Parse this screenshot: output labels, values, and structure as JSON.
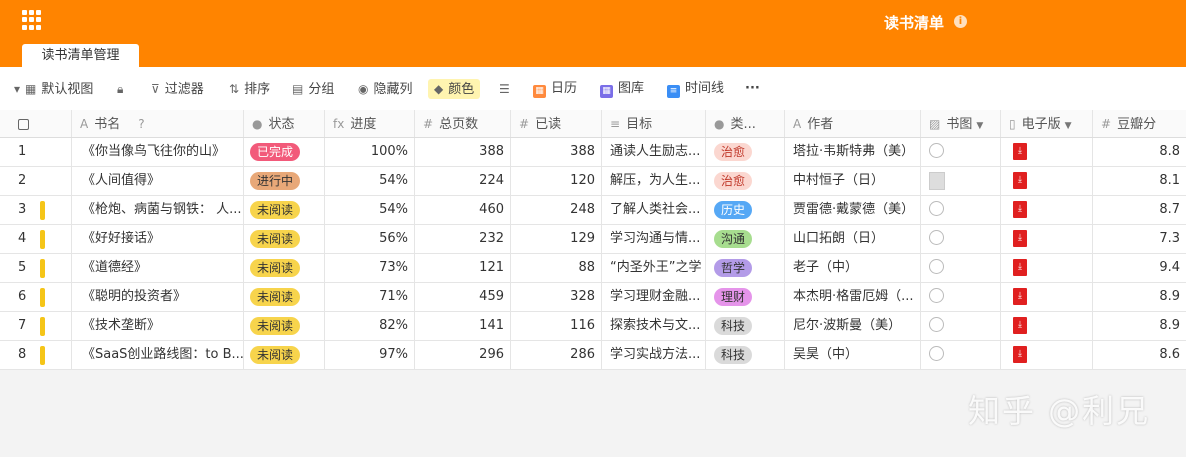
{
  "header": {
    "title": "读书清单",
    "tab": "读书清单管理"
  },
  "toolbar": {
    "view": "默认视图",
    "filter": "过滤器",
    "sort": "排序",
    "group": "分组",
    "hide": "隐藏列",
    "color": "颜色",
    "calendar": "日历",
    "gallery": "图库",
    "timeline": "时间线",
    "more": "···"
  },
  "columns": {
    "name": "书名",
    "status": "状态",
    "progress": "进度",
    "pages": "总页数",
    "read": "已读",
    "goal": "目标",
    "category": "类...",
    "author": "作者",
    "cover": "书图",
    "ebook": "电子版",
    "score": "豆瓣分"
  },
  "colors": {
    "accent": "#ff8400",
    "done": "#f25a7a",
    "inprogress": "#e8a878",
    "unread": "#f7d44c",
    "heal": "#fbd7d0",
    "history": "#56a8f5",
    "communicate": "#a7dd8f",
    "philosophy": "#b39be8",
    "finance": "#e594ea",
    "tech": "#dadada"
  },
  "rows": [
    {
      "n": "1",
      "name": "《你当像鸟飞往你的山》",
      "status": "已完成",
      "progress": "100%",
      "pages": "388",
      "read": "388",
      "goal": "通读人生励志...",
      "cat": "治愈",
      "author": "塔拉·韦斯特弗（美）",
      "score": "8.8"
    },
    {
      "n": "2",
      "name": "《人间值得》",
      "status": "进行中",
      "progress": "54%",
      "pages": "224",
      "read": "120",
      "goal": "解压，为人生...",
      "cat": "治愈",
      "author": "中村恒子（日）",
      "score": "8.1"
    },
    {
      "n": "3",
      "name": "《枪炮、病菌与钢铁： 人...",
      "status": "未阅读",
      "progress": "54%",
      "pages": "460",
      "read": "248",
      "goal": "了解人类社会...",
      "cat": "历史",
      "author": "贾雷德·戴蒙德（美）",
      "score": "8.7"
    },
    {
      "n": "4",
      "name": "《好好接话》",
      "status": "未阅读",
      "progress": "56%",
      "pages": "232",
      "read": "129",
      "goal": "学习沟通与情...",
      "cat": "沟通",
      "author": "山口拓朗（日）",
      "score": "7.3"
    },
    {
      "n": "5",
      "name": "《道德经》",
      "status": "未阅读",
      "progress": "73%",
      "pages": "121",
      "read": "88",
      "goal": "“内圣外王”之学",
      "cat": "哲学",
      "author": "老子（中）",
      "score": "9.4"
    },
    {
      "n": "6",
      "name": "《聪明的投资者》",
      "status": "未阅读",
      "progress": "71%",
      "pages": "459",
      "read": "328",
      "goal": "学习理财金融...",
      "cat": "理财",
      "author": "本杰明·格雷厄姆（...",
      "score": "8.9"
    },
    {
      "n": "7",
      "name": "《技术垄断》",
      "status": "未阅读",
      "progress": "82%",
      "pages": "141",
      "read": "116",
      "goal": "探索技术与文...",
      "cat": "科技",
      "author": "尼尔·波斯曼（美）",
      "score": "8.9"
    },
    {
      "n": "8",
      "name": "《SaaS创业路线图：to B...",
      "status": "未阅读",
      "progress": "97%",
      "pages": "296",
      "read": "286",
      "goal": "学习实战方法...",
      "cat": "科技",
      "author": "吴昊（中）",
      "score": "8.6"
    }
  ],
  "watermark": "知乎 @利兄"
}
